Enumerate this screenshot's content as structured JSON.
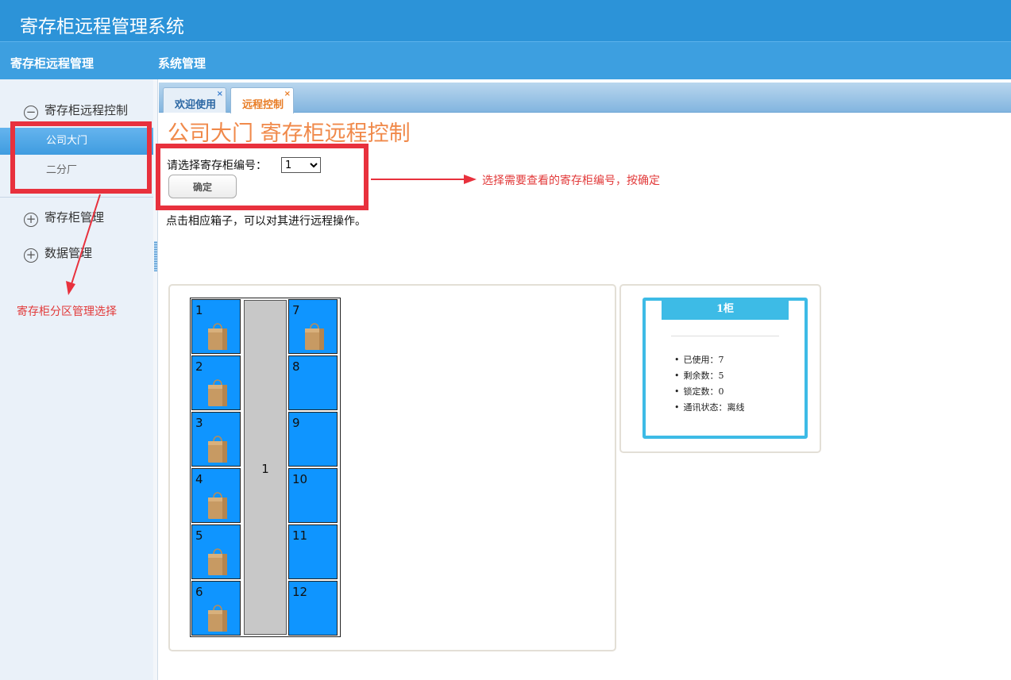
{
  "app": {
    "title": "寄存柜远程管理系统"
  },
  "nav": {
    "items": [
      "寄存柜远程管理",
      "系统管理"
    ]
  },
  "sidebar": {
    "group1": {
      "icon": "minus-circle-icon",
      "label": "寄存柜远程控制"
    },
    "sub_items": [
      "公司大门",
      "二分厂"
    ],
    "group2": {
      "icon": "plus-circle-icon",
      "label": "寄存柜管理"
    },
    "group3": {
      "icon": "plus-circle-icon",
      "label": "数据管理"
    }
  },
  "tabs": [
    {
      "label": "欢迎使用",
      "close": "×"
    },
    {
      "label": "远程控制",
      "close": "×"
    }
  ],
  "main": {
    "title": "公司大门 寄存柜远程控制",
    "select_label": "请选择寄存柜编号：",
    "select_value": "1",
    "confirm_label": "确定",
    "hint": "点击相应箱子，可以对其进行远程操作。"
  },
  "annotations": {
    "right": "选择需要查看的寄存柜编号，按确定",
    "left": "寄存柜分区管理选择"
  },
  "cabinet": {
    "center_label": "1",
    "left_cells": [
      {
        "num": "1",
        "occupied": true
      },
      {
        "num": "2",
        "occupied": true
      },
      {
        "num": "3",
        "occupied": true
      },
      {
        "num": "4",
        "occupied": true
      },
      {
        "num": "5",
        "occupied": true
      },
      {
        "num": "6",
        "occupied": true
      }
    ],
    "right_cells": [
      {
        "num": "7",
        "occupied": true
      },
      {
        "num": "8",
        "occupied": false
      },
      {
        "num": "9",
        "occupied": false
      },
      {
        "num": "10",
        "occupied": false
      },
      {
        "num": "11",
        "occupied": false
      },
      {
        "num": "12",
        "occupied": false
      }
    ]
  },
  "info": {
    "header": "1柜",
    "used": "已使用：7",
    "remaining": "剩余数：5",
    "locked": "锁定数：0",
    "status": "通讯状态：离线"
  },
  "colors": {
    "header": "#2c93d8",
    "cell": "#0f95ff",
    "annotation": "#e8313d",
    "card": "#3dbbe6"
  }
}
